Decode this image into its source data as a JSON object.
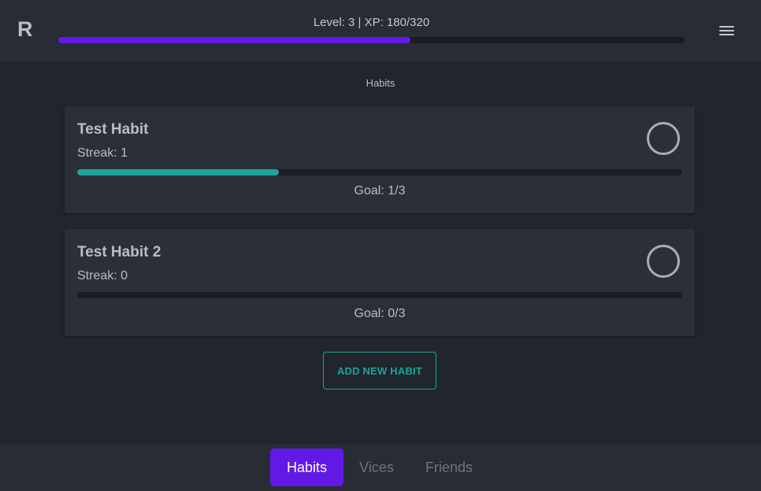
{
  "header": {
    "logo": "R",
    "level_text": "Level: 3 | XP: 180/320",
    "xp_progress": 0.5625,
    "xp_color": "#6319e6",
    "menu_icon": "hamburger-menu-icon"
  },
  "main": {
    "title": "Habits",
    "habits": [
      {
        "name": "Test Habit",
        "streak": "Streak: 1",
        "progress": 0.3333,
        "goal": "Goal: 1/3"
      },
      {
        "name": "Test Habit 2",
        "streak": "Streak: 0",
        "progress": 0,
        "goal": "Goal: 0/3"
      }
    ],
    "habit_progress_color": "#1fa39a",
    "add_button_label": "ADD NEW HABIT"
  },
  "nav": {
    "tabs": [
      {
        "label": "Habits",
        "active": true
      },
      {
        "label": "Vices",
        "active": false
      },
      {
        "label": "Friends",
        "active": false
      }
    ],
    "active_color": "#6319e6"
  }
}
